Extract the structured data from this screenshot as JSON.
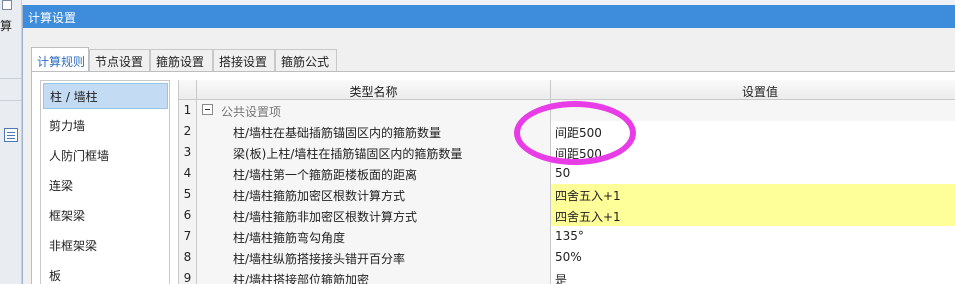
{
  "background": {
    "corner_text": "算",
    "accent_color": "#3e8ddd"
  },
  "dialog": {
    "title": "计算设置"
  },
  "tabs": [
    {
      "label": "计算规则",
      "active": true
    },
    {
      "label": "节点设置",
      "active": false
    },
    {
      "label": "箍筋设置",
      "active": false
    },
    {
      "label": "搭接设置",
      "active": false
    },
    {
      "label": "箍筋公式",
      "active": false
    }
  ],
  "categories": [
    {
      "label": "柱 / 墙柱",
      "selected": true
    },
    {
      "label": "剪力墙",
      "selected": false
    },
    {
      "label": "人防门框墙",
      "selected": false
    },
    {
      "label": "连梁",
      "selected": false
    },
    {
      "label": "框架梁",
      "selected": false
    },
    {
      "label": "非框架梁",
      "selected": false
    },
    {
      "label": "板",
      "selected": false
    }
  ],
  "table": {
    "headers": {
      "name": "类型名称",
      "value": "设置值"
    },
    "rows": [
      {
        "num": "1",
        "name": "公共设置项",
        "value": "",
        "group": true,
        "highlight": false
      },
      {
        "num": "2",
        "name": "柱/墙柱在基础插筋锚固区内的箍筋数量",
        "value": "间距500",
        "group": false,
        "highlight": false
      },
      {
        "num": "3",
        "name": "梁(板)上柱/墙柱在插筋锚固区内的箍筋数量",
        "value": "间距500",
        "group": false,
        "highlight": false
      },
      {
        "num": "4",
        "name": "柱/墙柱第一个箍筋距楼板面的距离",
        "value": "50",
        "group": false,
        "highlight": false
      },
      {
        "num": "5",
        "name": "柱/墙柱箍筋加密区根数计算方式",
        "value": "四舍五入+1",
        "group": false,
        "highlight": true
      },
      {
        "num": "6",
        "name": "柱/墙柱箍筋非加密区根数计算方式",
        "value": "四舍五入+1",
        "group": false,
        "highlight": true
      },
      {
        "num": "7",
        "name": "柱/墙柱箍筋弯勾角度",
        "value": "135°",
        "group": false,
        "highlight": false
      },
      {
        "num": "8",
        "name": "柱/墙柱纵筋搭接接头错开百分率",
        "value": "50%",
        "group": false,
        "highlight": false
      },
      {
        "num": "9",
        "name": "柱/墙柱搭接部位箍筋加密",
        "value": "是",
        "group": false,
        "highlight": false
      }
    ]
  },
  "annotation": {
    "color": "#e83ce6",
    "shape": "ellipse"
  }
}
